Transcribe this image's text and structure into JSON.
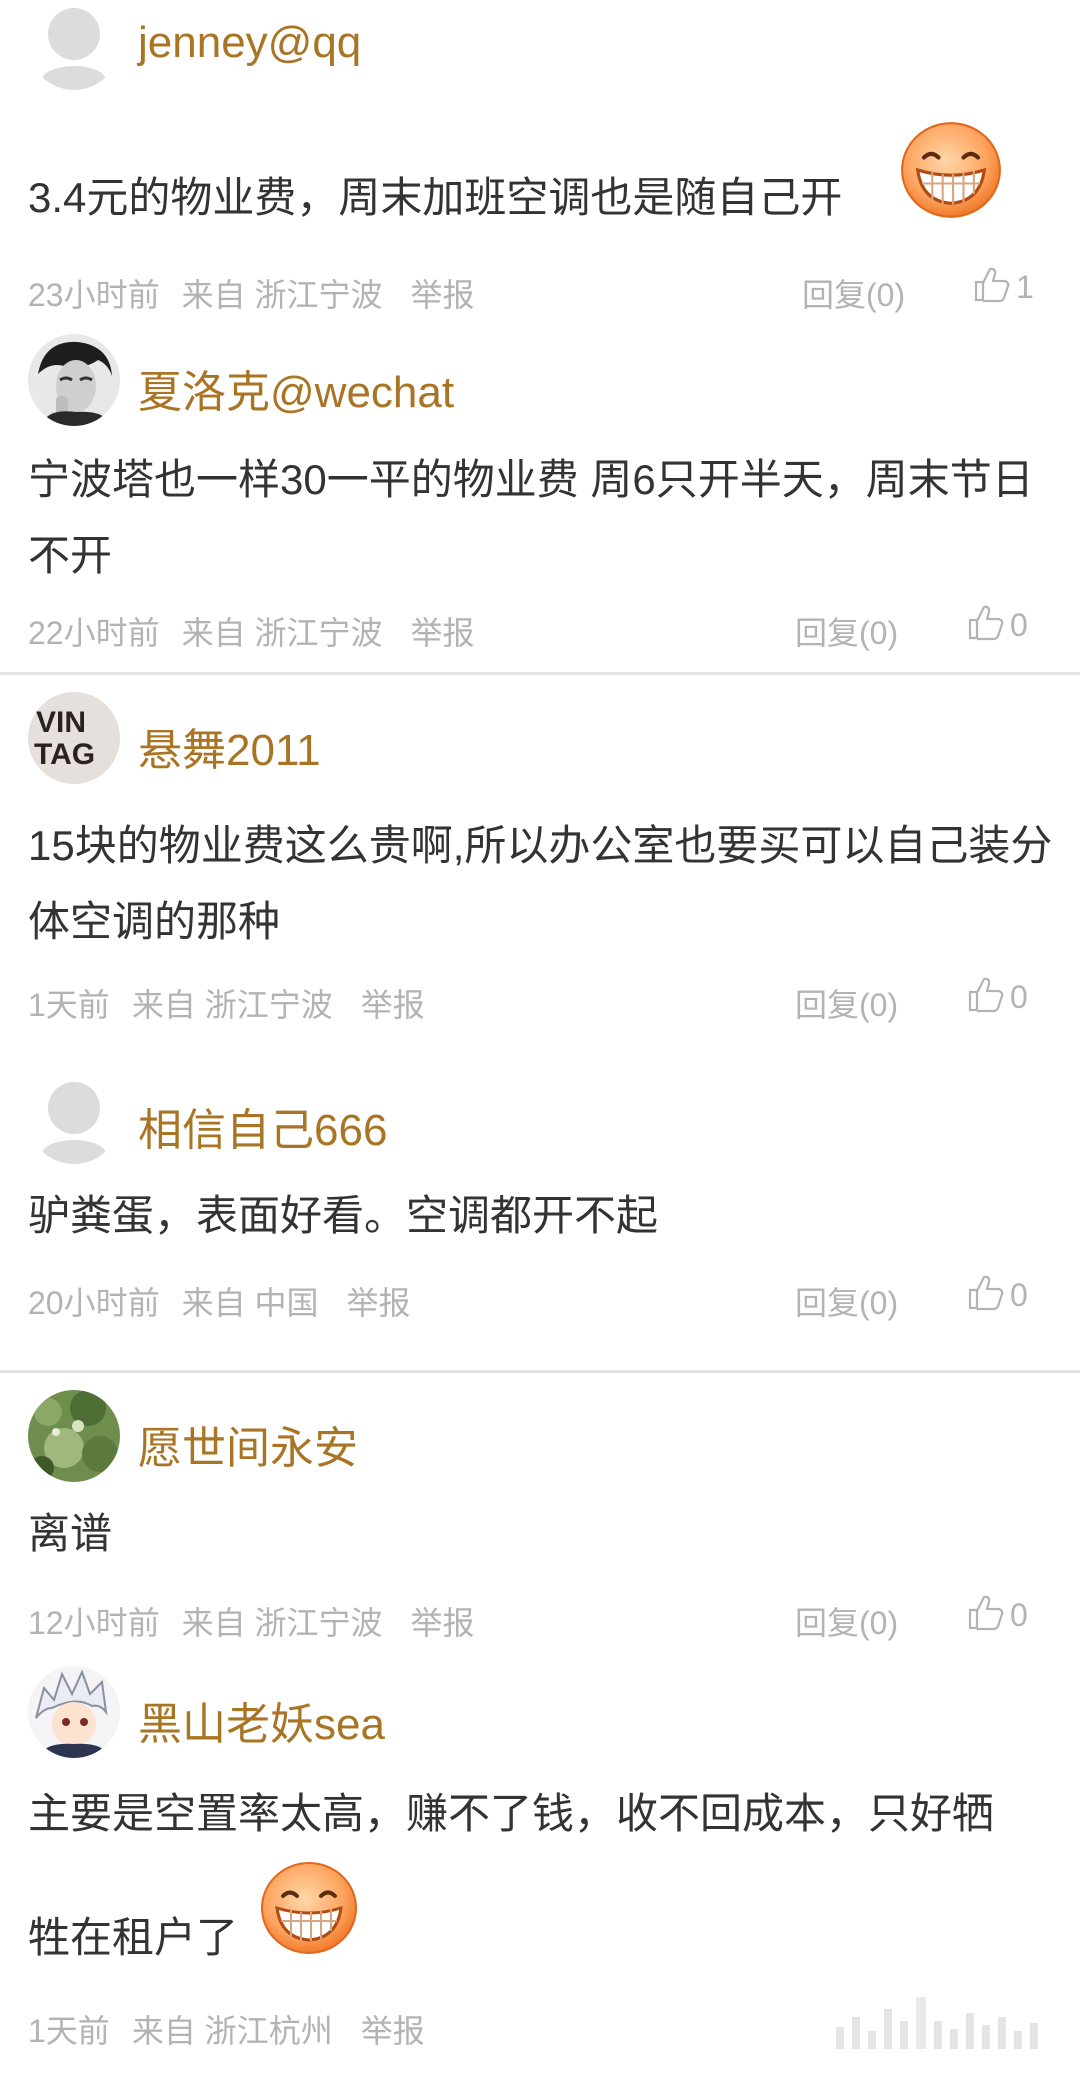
{
  "comments": [
    {
      "username": "jenney@qq",
      "text": "3.4元的物业费，周末加班空调也是随自己开",
      "time": "23小时前",
      "source": "来自 浙江宁波",
      "report": "举报",
      "reply": "回复(0)",
      "likes": "1",
      "avatar": "default-avatar",
      "emoji": "grin-emoji"
    },
    {
      "username": "夏洛克@wechat",
      "text": "宁波塔也一样30一平的物业费 周6只开半天，周末节日不开",
      "time": "22小时前",
      "source": "来自 浙江宁波",
      "report": "举报",
      "reply": "回复(0)",
      "likes": "0",
      "avatar": "photo-avatar"
    },
    {
      "username": "悬舞2011",
      "text": "15块的物业费这么贵啊,所以办公室也要买可以自己装分体空调的那种",
      "time": "1天前",
      "source": "来自 浙江宁波",
      "report": "举报",
      "reply": "回复(0)",
      "likes": "0",
      "avatar": "vintage-avatar"
    },
    {
      "username": "相信自己666",
      "text": "驴粪蛋，表面好看。空调都开不起",
      "time": "20小时前",
      "source": "来自 中国",
      "report": "举报",
      "reply": "回复(0)",
      "likes": "0",
      "avatar": "default-avatar"
    },
    {
      "username": "愿世间永安",
      "text": "离谱",
      "time": "12小时前",
      "source": "来自 浙江宁波",
      "report": "举报",
      "reply": "回复(0)",
      "likes": "0",
      "avatar": "nature-avatar"
    },
    {
      "username": "黑山老妖sea",
      "text_line1": "主要是空置率太高，赚不了钱，收不回成本，只好牺",
      "text_line2": "牲在租户了",
      "time": "1天前",
      "source": "来自 浙江杭州",
      "report": "举报",
      "avatar": "anime-avatar",
      "emoji": "grin-emoji"
    }
  ],
  "colors": {
    "username": "#a97524",
    "text": "#333333",
    "meta": "#b3b3b3",
    "divider": "#e3e3e3"
  }
}
